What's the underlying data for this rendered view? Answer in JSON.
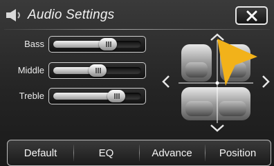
{
  "header": {
    "title": "Audio Settings"
  },
  "icons": {
    "app": "speaker-icon",
    "close": "close-icon"
  },
  "sliders": [
    {
      "label": "Bass",
      "value": 0.62
    },
    {
      "label": "Middle",
      "value": 0.5
    },
    {
      "label": "Treble",
      "value": 0.72
    }
  ],
  "seat_balance": {
    "arrows": [
      "up",
      "down",
      "left",
      "right"
    ]
  },
  "tabs": [
    "Default",
    "EQ",
    "Advance",
    "Position"
  ],
  "colors": {
    "accent": "#f2b21a",
    "text": "#f2f2f2"
  }
}
